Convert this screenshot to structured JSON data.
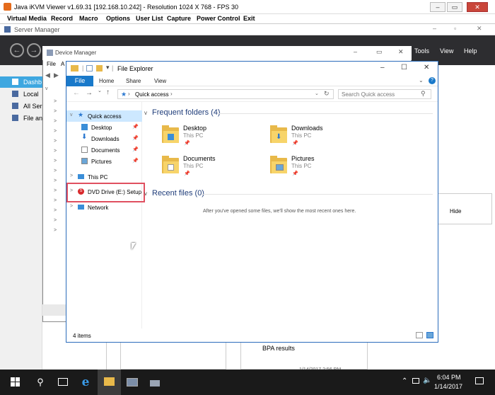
{
  "kvm": {
    "title": "Java iKVM Viewer v1.69.31 [192.168.10.242]  - Resolution 1024 X 768 - FPS 30",
    "menu": [
      "Virtual Media",
      "Record",
      "Macro",
      "Options",
      "User List",
      "Capture",
      "Power Control",
      "Exit"
    ]
  },
  "server_manager": {
    "title": "Server Manager",
    "menu": [
      "Tools",
      "View",
      "Help"
    ],
    "sidebar": [
      "Dashb",
      "Local",
      "All Ser",
      "File an"
    ],
    "hide_label": "Hide",
    "bpa_label": "BPA results",
    "bpa_date": "1/14/2017 2:56 PM"
  },
  "device_manager": {
    "title": "Device Manager",
    "menu_file": "File",
    "menu_action": "A"
  },
  "file_explorer": {
    "title": "File Explorer",
    "tabs": [
      "File",
      "Home",
      "Share",
      "View"
    ],
    "address": "Quick access",
    "search_placeholder": "Search Quick access",
    "nav": {
      "quick_access": "Quick access",
      "items": [
        "Desktop",
        "Downloads",
        "Documents",
        "Pictures"
      ],
      "this_pc": "This PC",
      "dvd": "DVD Drive (E:) Setup",
      "network": "Network"
    },
    "frequent_title": "Frequent folders (4)",
    "folders": [
      {
        "name": "Desktop",
        "location": "This PC"
      },
      {
        "name": "Downloads",
        "location": "This PC"
      },
      {
        "name": "Documents",
        "location": "This PC"
      },
      {
        "name": "Pictures",
        "location": "This PC"
      }
    ],
    "recent_title": "Recent files (0)",
    "recent_empty": "After you've opened some files, we'll show the most recent ones here.",
    "status": "4 items"
  },
  "taskbar": {
    "time": "6:04 PM",
    "date": "1/14/2017"
  }
}
